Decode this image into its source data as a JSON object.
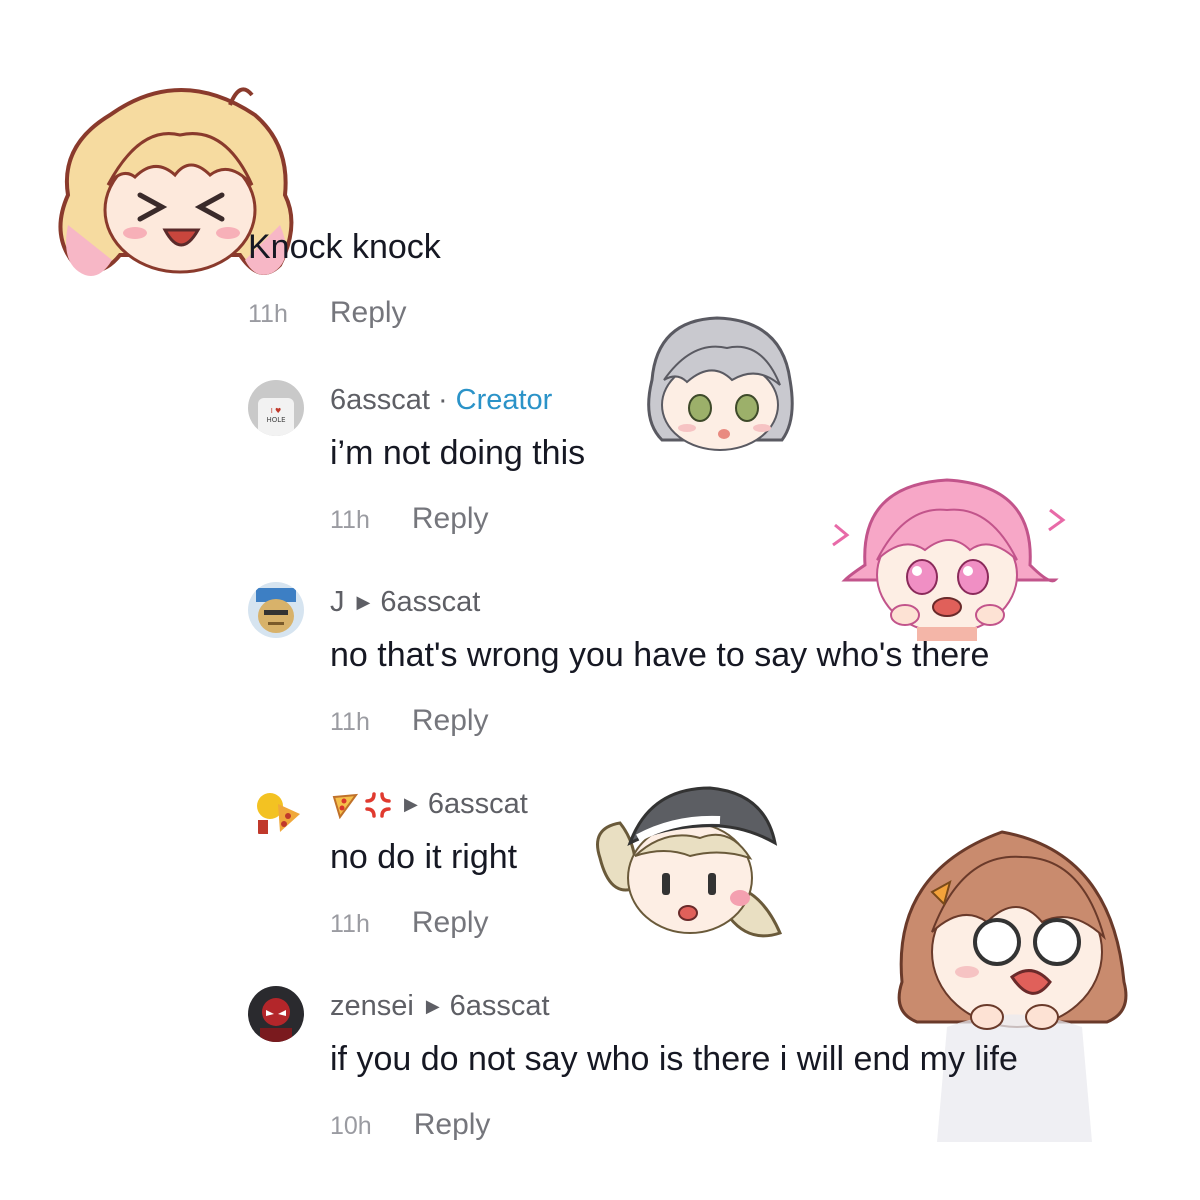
{
  "main_comment": {
    "text": "Knock knock",
    "time": "11h",
    "reply_label": "Reply"
  },
  "replies": [
    {
      "username": "6asscat",
      "creator_badge": "Creator",
      "text": "i’m not doing this",
      "time": "11h",
      "reply_label": "Reply",
      "avatar_text": "I ♥ HOLE"
    },
    {
      "username": "J",
      "reply_to": "6asscat",
      "text": "no that's wrong you have to say who's there",
      "time": "11h",
      "reply_label": "Reply"
    },
    {
      "username_emojis": [
        "pizza-emoji",
        "anger-emoji"
      ],
      "reply_to": "6asscat",
      "text": "no do it right",
      "time": "11h",
      "reply_label": "Reply"
    },
    {
      "username": "zensei",
      "reply_to": "6asscat",
      "text": "if you do not say who is there i will end my life",
      "time": "10h",
      "reply_label": "Reply"
    }
  ],
  "separator": "·",
  "reply_arrow": "▶",
  "colors": {
    "creator": "#2b93c8",
    "meta": "#9a9ba1",
    "reply": "#75767c",
    "text": "#161823"
  }
}
